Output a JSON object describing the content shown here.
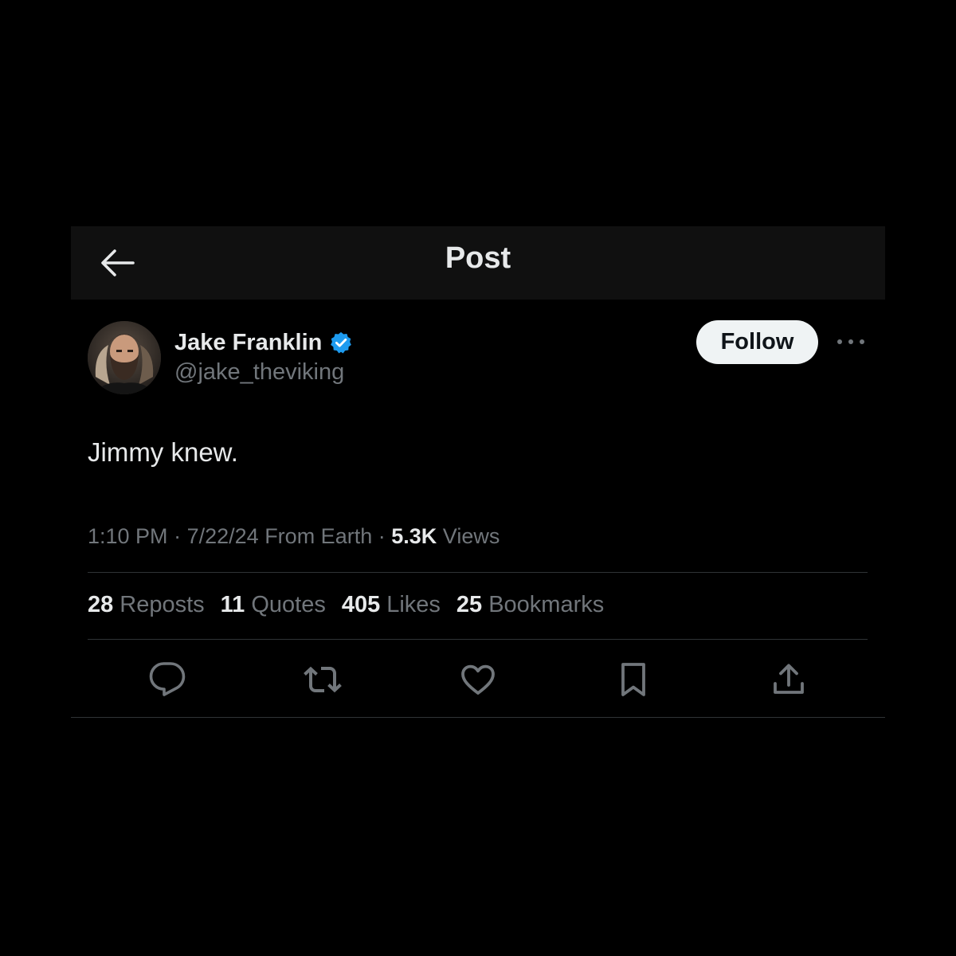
{
  "header": {
    "title": "Post",
    "back_icon": "arrow-left-icon"
  },
  "author": {
    "display_name": "Jake Franklin",
    "handle": "@jake_theviking",
    "verified": true,
    "verified_color": "#1d9bf0"
  },
  "follow_label": "Follow",
  "more_icon": "more-horizontal-icon",
  "post": {
    "text": "Jimmy knew.",
    "time": "1:10 PM",
    "date": "7/22/24",
    "location": "From Earth",
    "views_count": "5.3K",
    "views_label": "Views"
  },
  "stats": [
    {
      "count": "28",
      "label": "Reposts"
    },
    {
      "count": "11",
      "label": "Quotes"
    },
    {
      "count": "405",
      "label": "Likes"
    },
    {
      "count": "25",
      "label": "Bookmarks"
    }
  ],
  "actions": [
    {
      "name": "reply-icon"
    },
    {
      "name": "repost-icon"
    },
    {
      "name": "like-icon"
    },
    {
      "name": "bookmark-icon"
    },
    {
      "name": "share-icon"
    }
  ],
  "colors": {
    "background": "#000000",
    "header_bg": "#101010",
    "text_primary": "#e7e9ea",
    "text_secondary": "#71767b",
    "divider": "#2f3336",
    "follow_bg": "#eff3f4"
  }
}
